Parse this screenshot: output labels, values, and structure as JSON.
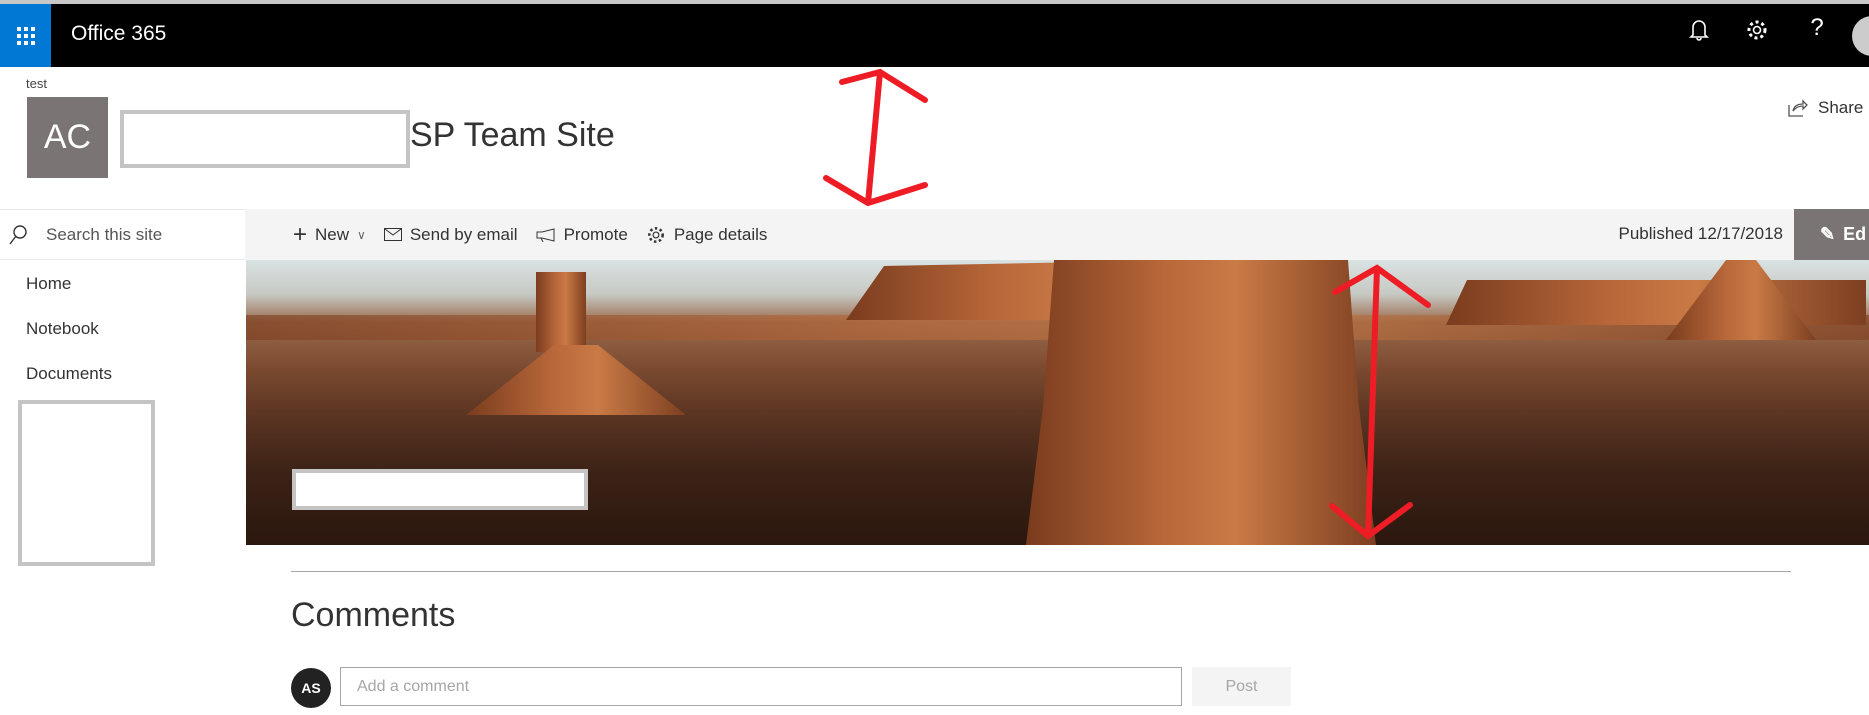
{
  "suite_bar": {
    "app_title": "Office 365",
    "icons": [
      "waffle-icon",
      "bell-icon",
      "gear-icon",
      "help-icon",
      "avatar"
    ],
    "waffle_color": "#0078d4",
    "help_glyph": "?"
  },
  "header": {
    "breadcrumb": "test",
    "logo_initials": "AC",
    "site_title": "SP Team Site",
    "share_label": "Share"
  },
  "search": {
    "placeholder": "Search this site"
  },
  "command_bar": {
    "new_label": "New",
    "send_email_label": "Send by email",
    "promote_label": "Promote",
    "page_details_label": "Page details",
    "published": "Published 12/17/2018",
    "edit_label": "Ed"
  },
  "nav": {
    "items": [
      {
        "label": "Home"
      },
      {
        "label": "Notebook"
      },
      {
        "label": "Documents"
      }
    ]
  },
  "comments": {
    "title": "Comments",
    "avatar_initials": "AS",
    "placeholder": "Add a comment",
    "post_label": "Post"
  },
  "colors": {
    "logo_bg": "#7a7574",
    "annotation": "#ee1c25"
  }
}
